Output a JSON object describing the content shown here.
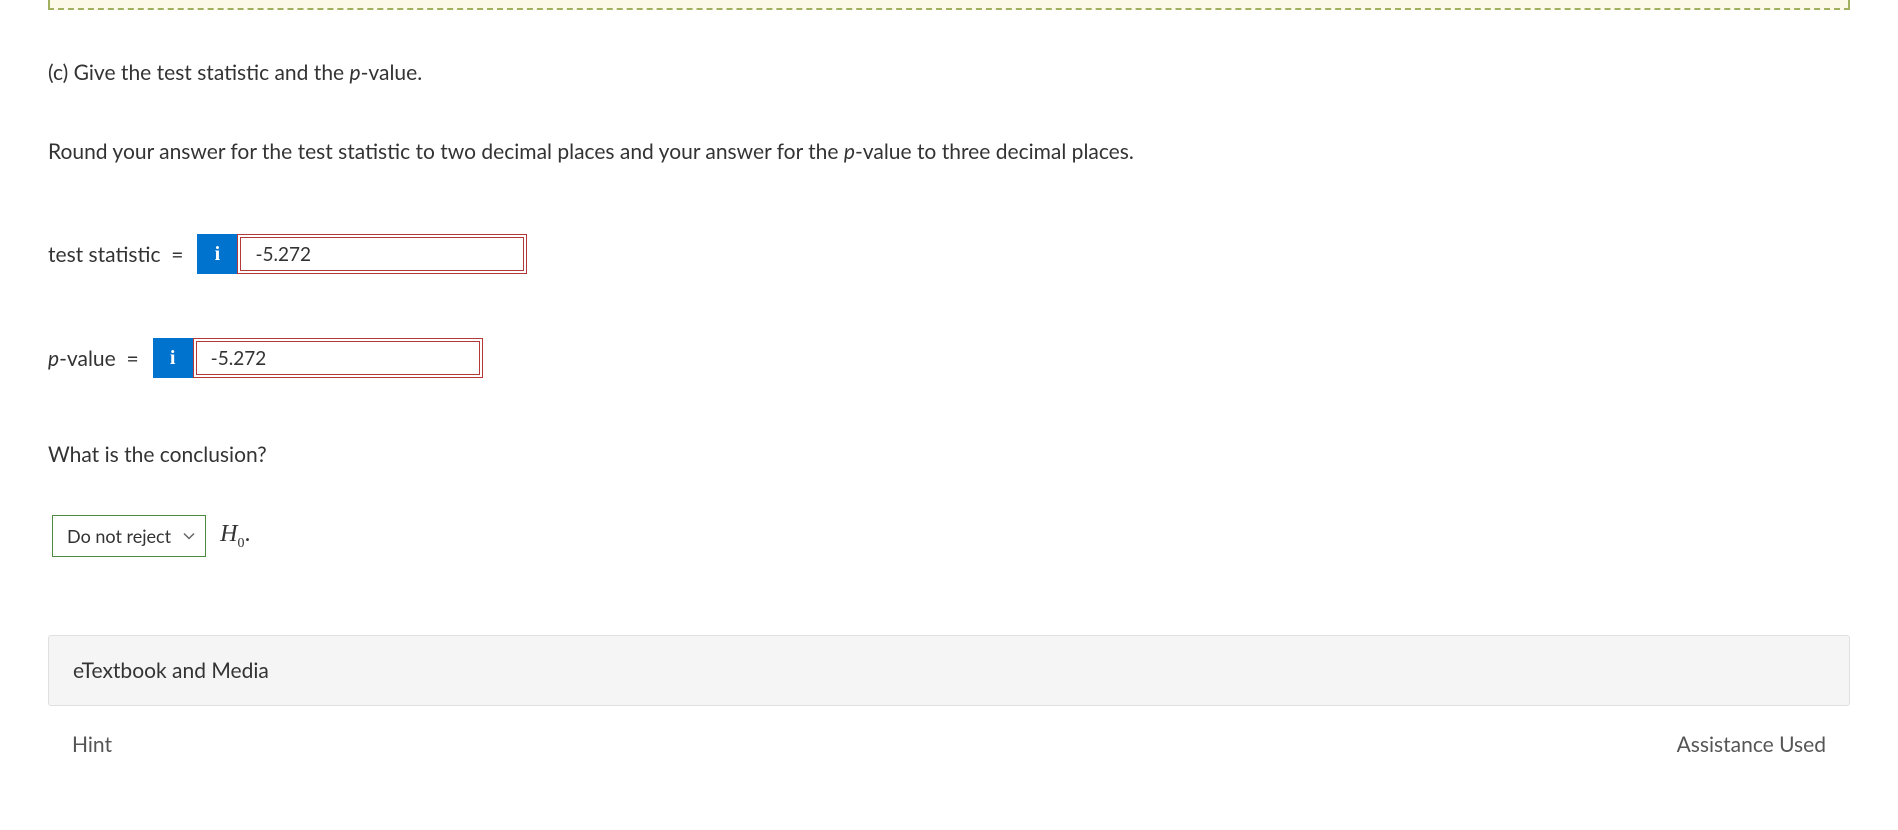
{
  "question": {
    "part_label": "(c) Give the test statistic and the ",
    "p_value_word": "p",
    "part_label_suffix": "-value."
  },
  "instruction": {
    "prefix": "Round your answer for the test statistic to two decimal places and your answer for the ",
    "p_word": "p",
    "suffix": "-value to three decimal places."
  },
  "inputs": {
    "test_statistic": {
      "label_prefix": "test statistic",
      "equals": "=",
      "value": "-5.272"
    },
    "p_value": {
      "p_word": "p",
      "label_suffix": "-value",
      "equals": "=",
      "value": "-5.272"
    },
    "info_icon_glyph": "i"
  },
  "conclusion": {
    "question": "What is the conclusion?",
    "select_value": "Do not reject",
    "hypothesis_letter": "H",
    "hypothesis_sub": "0",
    "hypothesis_dot": "."
  },
  "sections": {
    "etextbook": "eTextbook and Media",
    "hint": "Hint",
    "assistance": "Assistance Used"
  }
}
